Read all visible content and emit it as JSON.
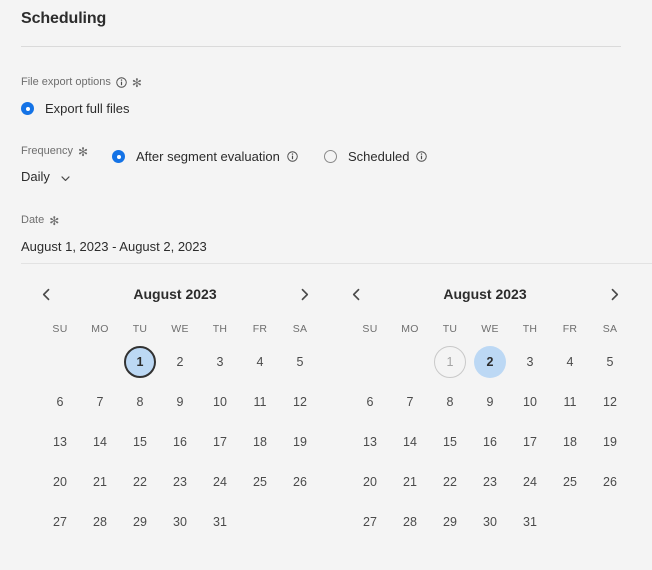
{
  "header": {
    "title": "Scheduling"
  },
  "file_export": {
    "label": "File export options",
    "info_icon": "info-circle-icon",
    "required_marker": "✻",
    "options": [
      {
        "label": "Export full files",
        "selected": true
      }
    ]
  },
  "frequency": {
    "label": "Frequency",
    "required_marker": "✻",
    "dropdown_value": "Daily",
    "dropdown_icon": "chevron-down-icon",
    "options": [
      {
        "label": "After segment evaluation",
        "selected": true,
        "info_icon": "info-circle-icon"
      },
      {
        "label": "Scheduled",
        "selected": false,
        "info_icon": "info-circle-icon"
      }
    ]
  },
  "date": {
    "label": "Date",
    "required_marker": "✻",
    "value": "August 1, 2023 - August 2, 2023"
  },
  "calendars": {
    "prev_icon": "chevron-left-icon",
    "next_icon": "chevron-right-icon",
    "day_headers": [
      "SU",
      "MO",
      "TU",
      "WE",
      "TH",
      "FR",
      "SA"
    ],
    "left": {
      "title": "August 2023",
      "lead_blanks": 2,
      "days": [
        1,
        2,
        3,
        4,
        5,
        6,
        7,
        8,
        9,
        10,
        11,
        12,
        13,
        14,
        15,
        16,
        17,
        18,
        19,
        20,
        21,
        22,
        23,
        24,
        25,
        26,
        27,
        28,
        29,
        30,
        31
      ],
      "focus_selected": [
        1
      ],
      "selected": [],
      "outlined": []
    },
    "right": {
      "title": "August 2023",
      "lead_blanks": 2,
      "days": [
        1,
        2,
        3,
        4,
        5,
        6,
        7,
        8,
        9,
        10,
        11,
        12,
        13,
        14,
        15,
        16,
        17,
        18,
        19,
        20,
        21,
        22,
        23,
        24,
        25,
        26,
        27,
        28,
        29,
        30,
        31
      ],
      "focus_selected": [],
      "selected": [
        2
      ],
      "outlined": [
        1
      ]
    }
  },
  "colors": {
    "background": "#f4f4f4",
    "accent_blue": "#1473e6",
    "selection_blue": "#bcd8f4",
    "text": "#2c2c2c",
    "muted_text": "#6e6e6e",
    "divider": "#dadada"
  }
}
